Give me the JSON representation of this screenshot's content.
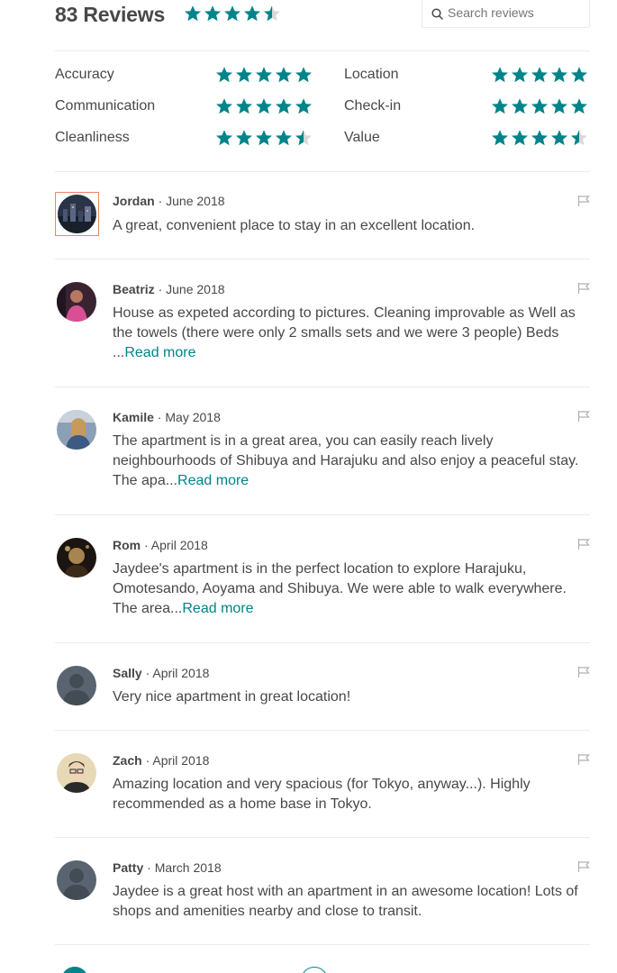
{
  "header": {
    "review_count": "83 Reviews",
    "overall_rating": 4.5,
    "search_placeholder": "Search reviews",
    "search_icon": "search-icon"
  },
  "categories": [
    {
      "label": "Accuracy",
      "rating": 5
    },
    {
      "label": "Communication",
      "rating": 5
    },
    {
      "label": "Cleanliness",
      "rating": 4.5
    },
    {
      "label": "Location",
      "rating": 5
    },
    {
      "label": "Check-in",
      "rating": 5
    },
    {
      "label": "Value",
      "rating": 4.5
    }
  ],
  "colors": {
    "star": "#008489",
    "star_empty": "#d8d8d8",
    "link": "#008489",
    "text": "#484848",
    "avatar_frame": "#e7866a"
  },
  "reviews": [
    {
      "name": "Jordan",
      "date": "June 2018",
      "text": "A great, convenient place to stay in an excellent location.",
      "read_more": ""
    },
    {
      "name": "Beatriz",
      "date": "June 2018",
      "text": "House as expeted according to pictures. Cleaning improvable as Well as the towels (there were only 2 smalls sets and we were 3 people) Beds ...",
      "read_more": "Read more"
    },
    {
      "name": "Kamile",
      "date": "May 2018",
      "text": "The apartment is in a great area, you can easily reach lively neighbourhoods of Shibuya and Harajuku and also enjoy a peaceful stay. The apa...",
      "read_more": "Read more"
    },
    {
      "name": "Rom",
      "date": "April 2018",
      "text": "Jaydee's apartment is in the perfect location to explore Harajuku, Omotesando, Aoyama and Shibuya. We were able to walk everywhere. The area...",
      "read_more": "Read more"
    },
    {
      "name": "Sally",
      "date": "April 2018",
      "text": "Very nice apartment in great location!",
      "read_more": ""
    },
    {
      "name": "Zach",
      "date": "April 2018",
      "text": "Amazing location and very spacious (for Tokyo, anyway...). Highly recommended as a home base in Tokyo.",
      "read_more": ""
    },
    {
      "name": "Patty",
      "date": "March 2018",
      "text": "Jaydee is a great host with an apartment in an awesome location! Lots of shops and amenities nearby and close to transit.",
      "read_more": ""
    }
  ],
  "separator": " · ",
  "flag_icon": "flag-icon"
}
